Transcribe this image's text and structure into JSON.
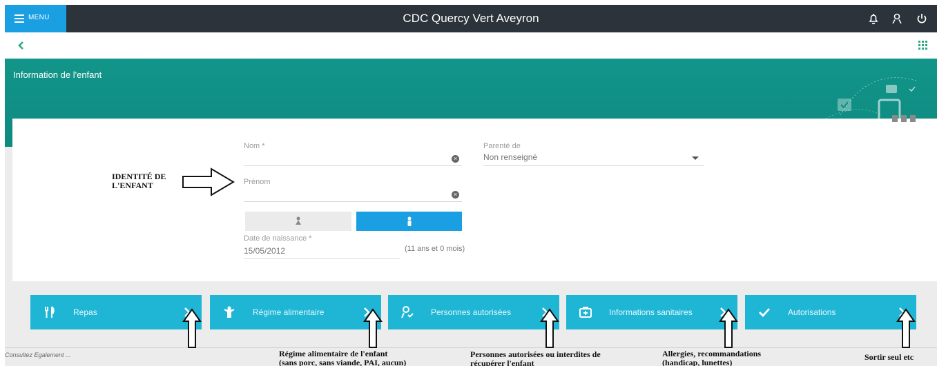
{
  "header": {
    "menu_label": "MENU",
    "app_title": "CDC Quercy Vert Aveyron"
  },
  "page": {
    "title": "Information de l'enfant"
  },
  "form": {
    "nom_label": "Nom *",
    "nom_value": "",
    "prenom_label": "Prénom",
    "prenom_value": "",
    "parente_label": "Parenté de",
    "parente_value": "Non renseigné",
    "dob_label": "Date de naissance *",
    "dob_value": "15/05/2012",
    "age_text": "(11 ans et 0 mois)"
  },
  "annotations": {
    "identite_line1": "IDENTITÉ DE",
    "identite_line2": "L'ENFANT",
    "regime_line1": "Régime alimentaire de l'enfant",
    "regime_line2": "(sans porc, sans viande, PAI, aucun)",
    "personnes_line1": "Personnes autorisées ou interdites de",
    "personnes_line2": "récupérer l'enfant",
    "allergies_line1": "Allergies, recommandations",
    "allergies_line2": "(handicap, lunettes)",
    "sortir": "Sortir seul etc"
  },
  "tiles": [
    {
      "label": "Repas",
      "icon": "fork-knife-icon"
    },
    {
      "label": "Régime alimentaire",
      "icon": "child-icon"
    },
    {
      "label": "Personnes autorisées",
      "icon": "person-check-icon"
    },
    {
      "label": "Informations sanitaires",
      "icon": "first-aid-kit-icon"
    },
    {
      "label": "Autorisations",
      "icon": "checkmark-icon"
    }
  ],
  "footer": {
    "text": "Consultez Egalement ..."
  },
  "colors": {
    "topbar": "#2c333a",
    "accent_blue": "#1a9fe3",
    "banner_teal": "#12958a",
    "tile_cyan": "#1fb6d6"
  }
}
